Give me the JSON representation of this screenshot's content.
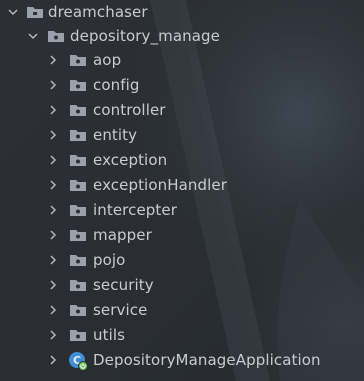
{
  "project_tree": {
    "root": {
      "label": "dreamchaser",
      "expanded": true,
      "icon": "folder-icon"
    },
    "package": {
      "label": "depository_manage",
      "expanded": true,
      "icon": "package-folder-icon"
    },
    "children": [
      {
        "label": "aop",
        "icon": "package-folder-icon",
        "expanded": false
      },
      {
        "label": "config",
        "icon": "package-folder-icon",
        "expanded": false
      },
      {
        "label": "controller",
        "icon": "package-folder-icon",
        "expanded": false
      },
      {
        "label": "entity",
        "icon": "package-folder-icon",
        "expanded": false
      },
      {
        "label": "exception",
        "icon": "package-folder-icon",
        "expanded": false
      },
      {
        "label": "exceptionHandler",
        "icon": "package-folder-icon",
        "expanded": false
      },
      {
        "label": "intercepter",
        "icon": "package-folder-icon",
        "expanded": false
      },
      {
        "label": "mapper",
        "icon": "package-folder-icon",
        "expanded": false
      },
      {
        "label": "pojo",
        "icon": "package-folder-icon",
        "expanded": false
      },
      {
        "label": "security",
        "icon": "package-folder-icon",
        "expanded": false
      },
      {
        "label": "service",
        "icon": "package-folder-icon",
        "expanded": false
      },
      {
        "label": "utils",
        "icon": "package-folder-icon",
        "expanded": false
      },
      {
        "label": "DepositoryManageApplication",
        "icon": "spring-boot-class-icon",
        "expanded": false
      }
    ]
  },
  "colors": {
    "text": "#c8ccd2",
    "folder": "#9aa1aa",
    "arrow": "#b3b8bf",
    "app_icon_blue": "#3f8fd6",
    "app_icon_green": "#6bbf59"
  }
}
